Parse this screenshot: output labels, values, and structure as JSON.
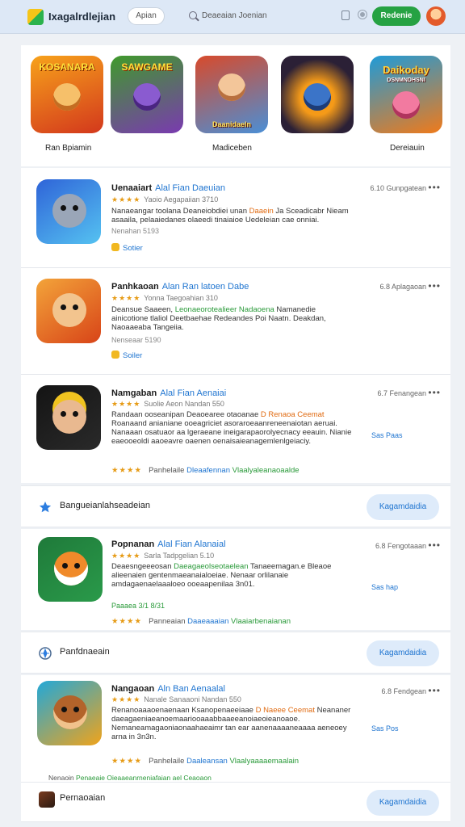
{
  "header": {
    "brand": "Ixagalrdlejian",
    "tab": "Apian",
    "search_placeholder": "Deaeaian Joenian",
    "action_button": "Redenie"
  },
  "featured": {
    "tiles": [
      {
        "title": "KOSANARA",
        "colors": [
          "#f7a21b",
          "#d3381c"
        ]
      },
      {
        "title": "SAWGAME",
        "subtitle": "",
        "colors": [
          "#3f9a2b",
          "#7a3ab0"
        ]
      },
      {
        "title": "",
        "subtitle": "Daanidaeln",
        "colors": [
          "#d84a2b",
          "#4a8fd6"
        ]
      },
      {
        "title": "",
        "colors": [
          "#2b2036",
          "#f59a18"
        ]
      },
      {
        "title": "Daikoday",
        "subtitle": "DSNMNDHSNI",
        "colors": [
          "#1f9bd8",
          "#f07a1a"
        ]
      }
    ],
    "labels": [
      "Ran Bpiamin",
      "Madiceben",
      "Dereiauin"
    ]
  },
  "apps": [
    {
      "title": "Uenaaiart",
      "title_hl": "Alal Fian Daeuian",
      "rating": "★★★★",
      "meta": "Yaoio  Aegapaiian 3710",
      "desc_1": "Nanaeangar toolana  Deaneiobdiei unan",
      "desc_hl": "Daaein",
      "desc_2": "Ja  Sceadicabr Nieam asaaila, pelaaiedanes olaeedi tinaiaioe Uedeleian cae onniai.",
      "tag": "Nenahan  5193",
      "pill": "Sotier",
      "side": "6.10 Gunpgatean",
      "colors": [
        "#2f64d8",
        "#55c2f1"
      ]
    },
    {
      "title": "Panhkaoan",
      "title_hl": "Alan Ran latoen Dabe",
      "rating": "★★★★",
      "meta": "Yonna  Taegoahian 310",
      "desc_1": "Deansue Saaeen,",
      "desc_hl": "Leonaeorotealieer Nadaoena",
      "desc_2": "Namanedie ainicotione tlaliol Deetbaehae Redeandes Poi Naatn. Deakdan, Naoaaeaba Tangeiia.",
      "tag": "Nenseaar  5190",
      "pill": "Soiler",
      "side": "6.8 Aplagaoan",
      "colors": [
        "#f3a43a",
        "#d84418"
      ]
    },
    {
      "title": "Namgaban",
      "title_hl": "Alal Fian Aenaiai",
      "rating": "★★★★",
      "meta": "Suolie  Aeon Nandan 550",
      "desc_1": "Randaan ooseanipan  Deaoearee otaoanae",
      "desc_hl": "D Renaoa Ceemat",
      "desc_2": "Roanaand anianiane ooeagriciet asoraroeaanreneenaiotan aeruai. Nanaaan osatuaor aa lgeraeane ineigarapaorolyecnacy eeauin. Nianie eaeooeoldi aaoeavre oaenen oenaisaieanagemlenlgeiaciy.",
      "tag": "",
      "pill": "",
      "side": "6.7 Fenangean",
      "link": "Sas Paas",
      "bottom_a": "Panhelaile",
      "bottom_b": "Dleaafennan",
      "bottom_c": "Vlaalyaleanaoaalde",
      "colors": [
        "#141414",
        "#f0c320"
      ]
    },
    {
      "title": "Popnanan",
      "title_hl": "Alal Fian Alanaial",
      "rating": "★★★★",
      "meta": "Sarla  Tadpgelian 5.10",
      "desc_1": "Deaesngeeeosan",
      "desc_hl": "Daeagaeolseotaelean",
      "desc_2": "Tanaeemagan.e  Bleaoe alieenaien gentenmaeanaialoeiae. Nenaar orlilanaie amdagaenaelaaaloeo ooeaapenilaa 3n01.",
      "tag": "Paaaea 3/1 8/31",
      "pill": "",
      "side": "6.8 Fengotaaan",
      "link": "Sas hap",
      "bottom_a": "Panneaian",
      "bottom_b": "Daaeaaaian",
      "bottom_c": "Vlaaiarbenaianan",
      "colors": [
        "#1f7a3a",
        "#f08a2a"
      ]
    },
    {
      "title": "Nangaoan",
      "title_hl": "Aln Ban Aenaalal",
      "rating": "★★★★",
      "meta": "Nanale  Sanaaoni Nandan 550",
      "desc_1": "Renanoaaaoenaenaan  Ksanopenaeeiaae",
      "desc_hl": "D Naeee Ceemat",
      "desc_2": "Neananer daeagaeniaeanoemaariooaaabbaaeeanoiaeoieanoaoe. Nemaneamagaoniaonaahaeaimr tan ear aanenaaaaneaaaa aeneoey arna in 3n3n.",
      "tag": "",
      "pill": "",
      "side": "6.8 Fendgean",
      "link": "Sas Pos",
      "bottom_a": "Panhelaile",
      "bottom_b": "Daaleansan",
      "bottom_c": "Vlaalyaaaaemaalain",
      "colors": [
        "#22a8d8",
        "#f0a31b"
      ]
    }
  ],
  "sections": [
    {
      "title": "Bangueianlahseadeian",
      "button": "Kagamdaidia",
      "icon": "star-icon"
    },
    {
      "title": "Panfdnaeain",
      "button": "Kagamdaidia",
      "icon": "compass-icon"
    },
    {
      "title": "Pernaoaian",
      "button": "Kagamdaidia",
      "icon": "game-icon"
    }
  ],
  "footer_line": {
    "a": "Nenaoin",
    "b": "Penaeaie Oieaaeanrneniafaian ael Ceaoaon"
  },
  "colors": {
    "accent": "#1e74d0",
    "green": "#26a243",
    "star": "#e69b16"
  }
}
